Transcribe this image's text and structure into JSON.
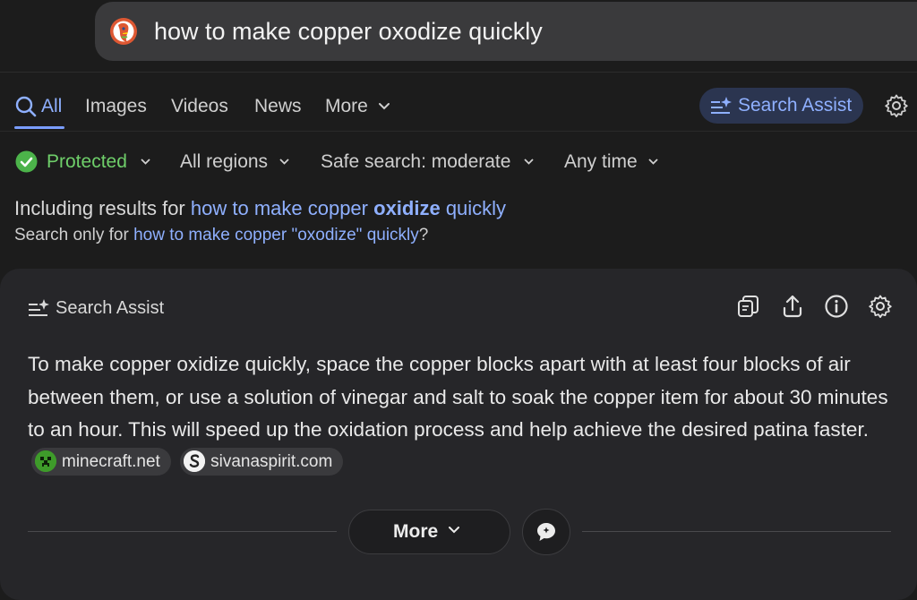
{
  "search": {
    "query": "how to make copper oxodize quickly"
  },
  "tabs": [
    {
      "label": "All",
      "active": true
    },
    {
      "label": "Images"
    },
    {
      "label": "Videos"
    },
    {
      "label": "News"
    },
    {
      "label": "More"
    }
  ],
  "assist_button": {
    "label": "Search Assist"
  },
  "filters": {
    "protection": "Protected",
    "region": "All regions",
    "safe_search": "Safe search: moderate",
    "time": "Any time"
  },
  "correction": {
    "including_prefix": "Including results for",
    "including_pre": "how to make copper ",
    "including_bold": "oxidize",
    "including_post": " quickly",
    "only_prefix": "Search only for",
    "only_link": "how to make copper \"oxodize\" quickly",
    "only_suffix": "?"
  },
  "assist_card": {
    "title": "Search Assist",
    "answer": "To make copper oxidize quickly, space the copper blocks apart with at least four blocks of air between them, or use a solution of vinegar and salt to soak the copper item for about 30 minutes to an hour. This will speed up the oxidation process and help achieve the desired patina faster.",
    "sources": [
      "minecraft.net",
      "sivanaspirit.com"
    ],
    "more_label": "More"
  },
  "colors": {
    "accent": "#8fb0ff",
    "protected_green": "#6fcf6a",
    "background": "#1c1c1c",
    "card": "#262629"
  },
  "icons": [
    "duckduckgo-logo",
    "search-icon",
    "chevron-down-icon",
    "sparkle-list-icon",
    "gear-icon",
    "check-circle-icon",
    "copy-icon",
    "share-icon",
    "info-icon",
    "chat-icon"
  ]
}
